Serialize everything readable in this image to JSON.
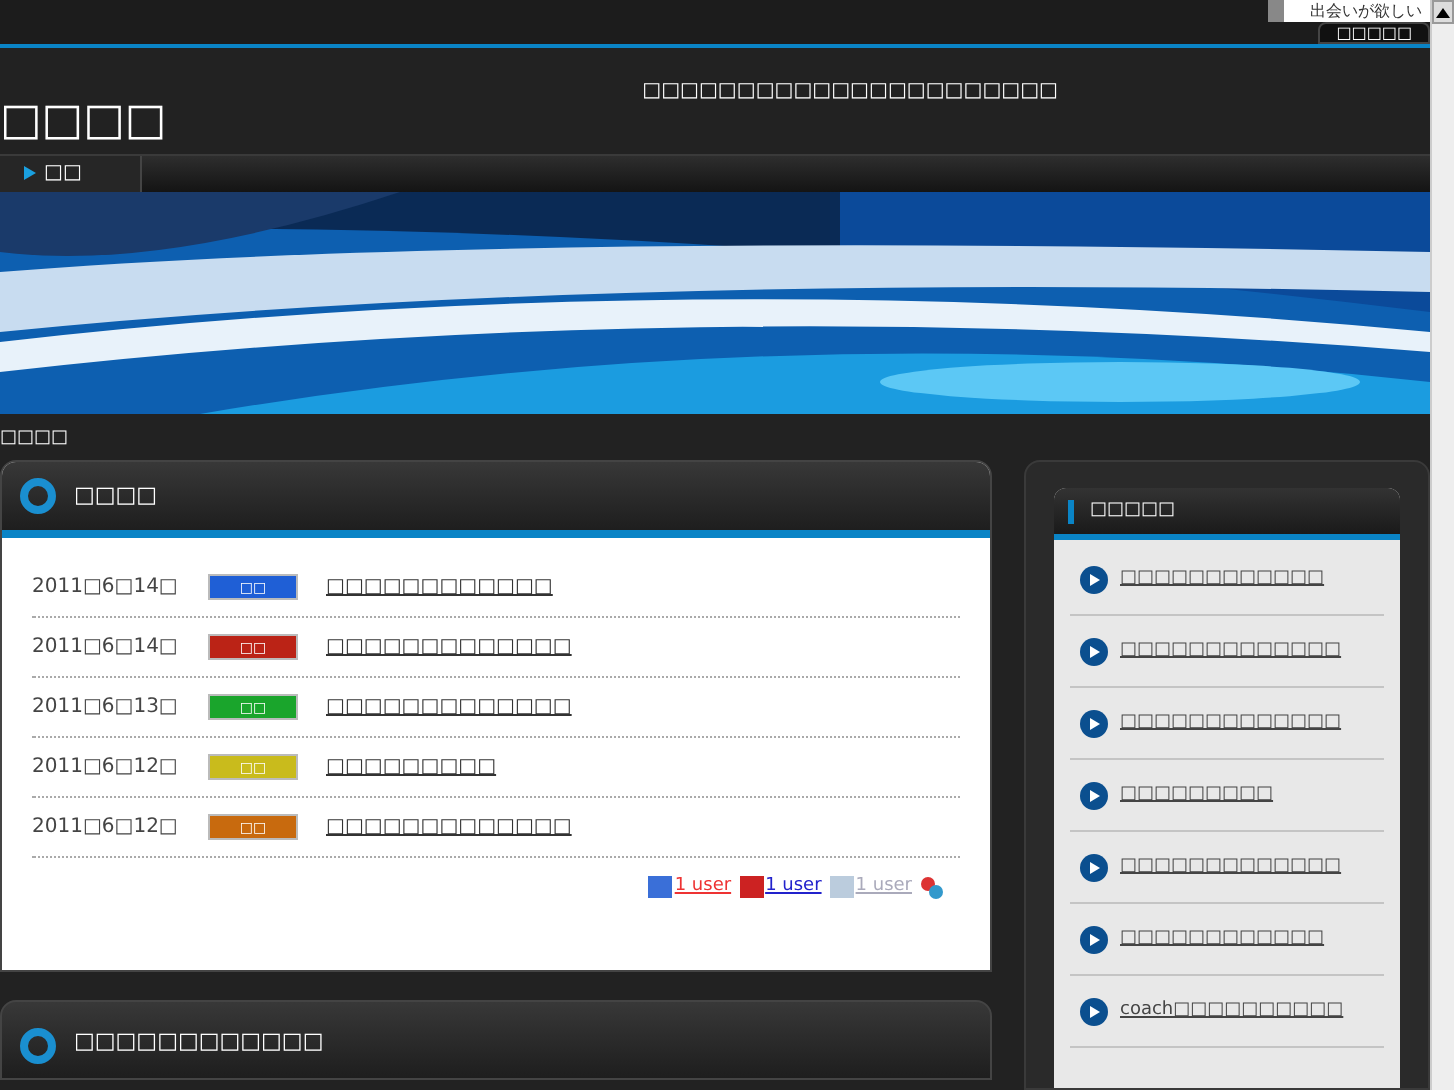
{
  "top_bar": {
    "search_value": "出会いが欲しい",
    "button": "□□□□□"
  },
  "header": {
    "title": "□□□□",
    "tagline": "□□□□□□□□□□□□□□□□□□□□□□"
  },
  "nav": {
    "items": [
      {
        "label": "□□",
        "selected": true
      }
    ]
  },
  "breadcrumb": "□□□□",
  "news": {
    "title": "□□□□",
    "rows": [
      {
        "date": "2011□6□14□",
        "tag": "□□",
        "color": "#1f5fd6",
        "link": "□□□□□□□□□□□□"
      },
      {
        "date": "2011□6□14□",
        "tag": "□□",
        "color": "#bb2316",
        "link": "□□□□□□□□□□□□□"
      },
      {
        "date": "2011□6□13□",
        "tag": "□□",
        "color": "#1aa52c",
        "link": "□□□□□□□□□□□□□"
      },
      {
        "date": "2011□6□12□",
        "tag": "□□",
        "color": "#c9bb1c",
        "link": "□□□□□□□□□"
      },
      {
        "date": "2011□6□12□",
        "tag": "□□",
        "color": "#c86a0e",
        "link": "□□□□□□□□□□□□□"
      }
    ],
    "bookmarks": [
      "1 user",
      "1 user",
      "1 user"
    ]
  },
  "second_panel": {
    "title": "□□□□□□□□□□□□"
  },
  "sidebar": {
    "title": "□□□□□",
    "items": [
      "□□□□□□□□□□□□",
      "□□□□□□□□□□□□□",
      "□□□□□□□□□□□□□",
      "□□□□□□□□□",
      "□□□□□□□□□□□□□",
      "□□□□□□□□□□□□",
      "coach□□□□□□□□□□"
    ]
  }
}
